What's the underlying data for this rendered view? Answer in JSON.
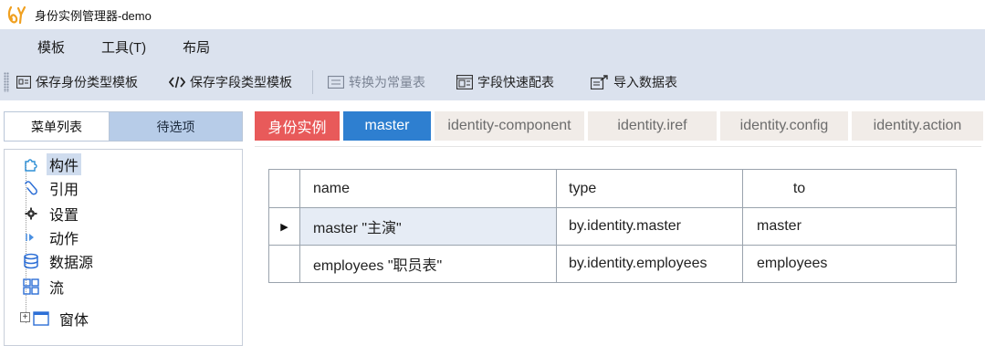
{
  "window": {
    "title": "身份实例管理器-demo",
    "logo_icon": "app-logo-icon"
  },
  "menubar": {
    "items": [
      "模板",
      "工具(T)",
      "布局"
    ]
  },
  "toolbar": {
    "buttons": [
      {
        "label": "保存身份类型模板",
        "icon": "form-icon",
        "enabled": true
      },
      {
        "label": "保存字段类型模板",
        "icon": "code-icon",
        "enabled": true
      },
      {
        "label": "转换为常量表",
        "icon": "list-icon",
        "enabled": false
      },
      {
        "label": "字段快速配表",
        "icon": "table-icon",
        "enabled": true
      },
      {
        "label": "导入数据表",
        "icon": "import-icon",
        "enabled": true
      }
    ]
  },
  "left_panel": {
    "tabs": [
      {
        "label": "菜单列表",
        "active": true
      },
      {
        "label": "待选项",
        "active": false
      }
    ],
    "tree": [
      {
        "label": "构件",
        "icon": "puzzle-icon",
        "selected": true
      },
      {
        "label": "引用",
        "icon": "link-icon",
        "selected": false
      },
      {
        "label": "设置",
        "icon": "gear-icon",
        "selected": false
      },
      {
        "label": "动作",
        "icon": "action-icon",
        "selected": false
      },
      {
        "label": "数据源",
        "icon": "database-icon",
        "selected": false
      },
      {
        "label": "流",
        "icon": "flow-icon",
        "selected": false
      },
      {
        "label": "窗体",
        "icon": "window-icon",
        "selected": false,
        "expandable": true
      }
    ]
  },
  "right_tabs": [
    {
      "label": "身份实例",
      "style": "red"
    },
    {
      "label": "master",
      "style": "active"
    },
    {
      "label": "identity-component",
      "style": "plain"
    },
    {
      "label": "identity.iref",
      "style": "plain"
    },
    {
      "label": "identity.config",
      "style": "plain"
    },
    {
      "label": "identity.action",
      "style": "plain"
    }
  ],
  "grid": {
    "columns": [
      "name",
      "type",
      "to"
    ],
    "rows": [
      {
        "name": "master \"主演\"",
        "type": "by.identity.master",
        "to": "master",
        "current": true
      },
      {
        "name": "employees \"职员表\"",
        "type": "by.identity.employees",
        "to": "employees",
        "current": false
      }
    ]
  },
  "colors": {
    "menubar_bg": "#dbe2ee",
    "tab_red": "#e85a5a",
    "tab_blue": "#2e7fd0",
    "tab_inactive_left": "#b7cce8"
  }
}
